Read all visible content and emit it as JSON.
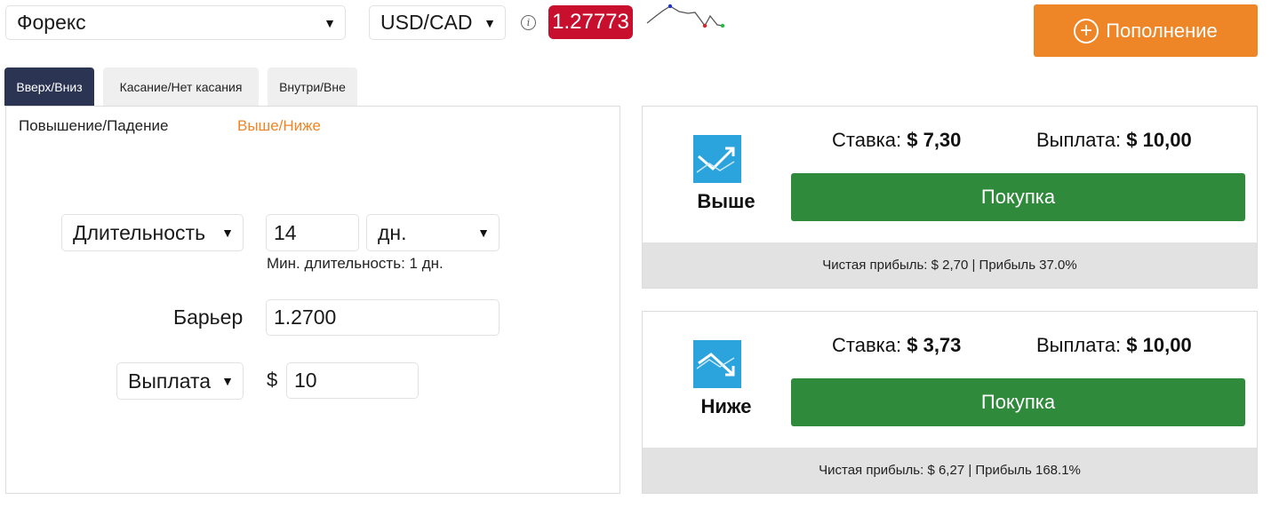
{
  "header": {
    "market": "Форекс",
    "pair": "USD/CAD",
    "spot_price": "1.27773",
    "deposit_label": "Пополнение"
  },
  "tabs": [
    {
      "label": "Вверх/Вниз",
      "active": true
    },
    {
      "label": "Касание/Нет касания",
      "active": false
    },
    {
      "label": "Внутри/Вне",
      "active": false
    }
  ],
  "subtabs": [
    {
      "label": "Повышение/Падение",
      "active": false
    },
    {
      "label": "Выше/Ниже",
      "active": true
    }
  ],
  "form": {
    "duration_type": "Длительность",
    "duration_value": "14",
    "duration_unit": "дн.",
    "min_duration": "Мин. длительность: 1 дн.",
    "barrier_label": "Барьер",
    "barrier_value": "1.2700",
    "amount_type": "Выплата",
    "currency_symbol": "$",
    "amount_value": "10"
  },
  "contracts": [
    {
      "name": "Выше",
      "stake_label": "Ставка:",
      "stake_value": "$ 7,30",
      "payout_label": "Выплата:",
      "payout_value": "$ 10,00",
      "buy_label": "Покупка",
      "footer": "Чистая прибыль: $ 2,70 | Прибыль 37.0%",
      "icon": "chart-up-icon"
    },
    {
      "name": "Ниже",
      "stake_label": "Ставка:",
      "stake_value": "$ 3,73",
      "payout_label": "Выплата:",
      "payout_value": "$ 10,00",
      "buy_label": "Покупка",
      "footer": "Чистая прибыль: $ 6,27 | Прибыль 168.1%",
      "icon": "chart-down-icon"
    }
  ],
  "colors": {
    "accent": "#ee8526",
    "spot_bg": "#c8102e",
    "active_tab": "#2c3454",
    "buy": "#2f8a3b",
    "icon_bg": "#2ba3dd"
  }
}
